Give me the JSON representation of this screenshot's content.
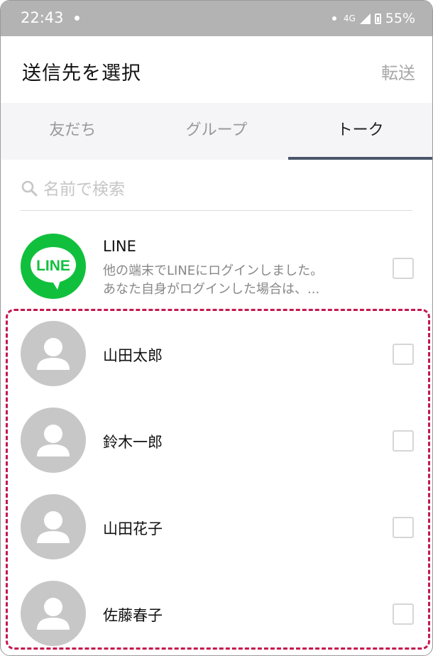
{
  "status_bar": {
    "time": "22:43",
    "network": "4G",
    "battery": "55%"
  },
  "header": {
    "title": "送信先を選択",
    "forward_label": "転送"
  },
  "tabs": [
    {
      "label": "友だち",
      "active": false
    },
    {
      "label": "グループ",
      "active": false
    },
    {
      "label": "トーク",
      "active": true
    }
  ],
  "search": {
    "placeholder": "名前で検索"
  },
  "chats": [
    {
      "name": "LINE",
      "avatar": "line-logo-icon",
      "logo_text": "LINE",
      "preview_line1": "他の端末でLINEにログインしました。",
      "preview_line2": "あなた自身がログインした場合は、..."
    },
    {
      "name": "山田太郎",
      "avatar": "default-user-icon"
    },
    {
      "name": "鈴木一郎",
      "avatar": "default-user-icon"
    },
    {
      "name": "山田花子",
      "avatar": "default-user-icon"
    },
    {
      "name": "佐藤春子",
      "avatar": "default-user-icon"
    }
  ],
  "colors": {
    "line_green": "#10c03d",
    "tab_indicator": "#4b566b",
    "highlight": "#c4174e",
    "status_bar": "#b3b3b3"
  }
}
